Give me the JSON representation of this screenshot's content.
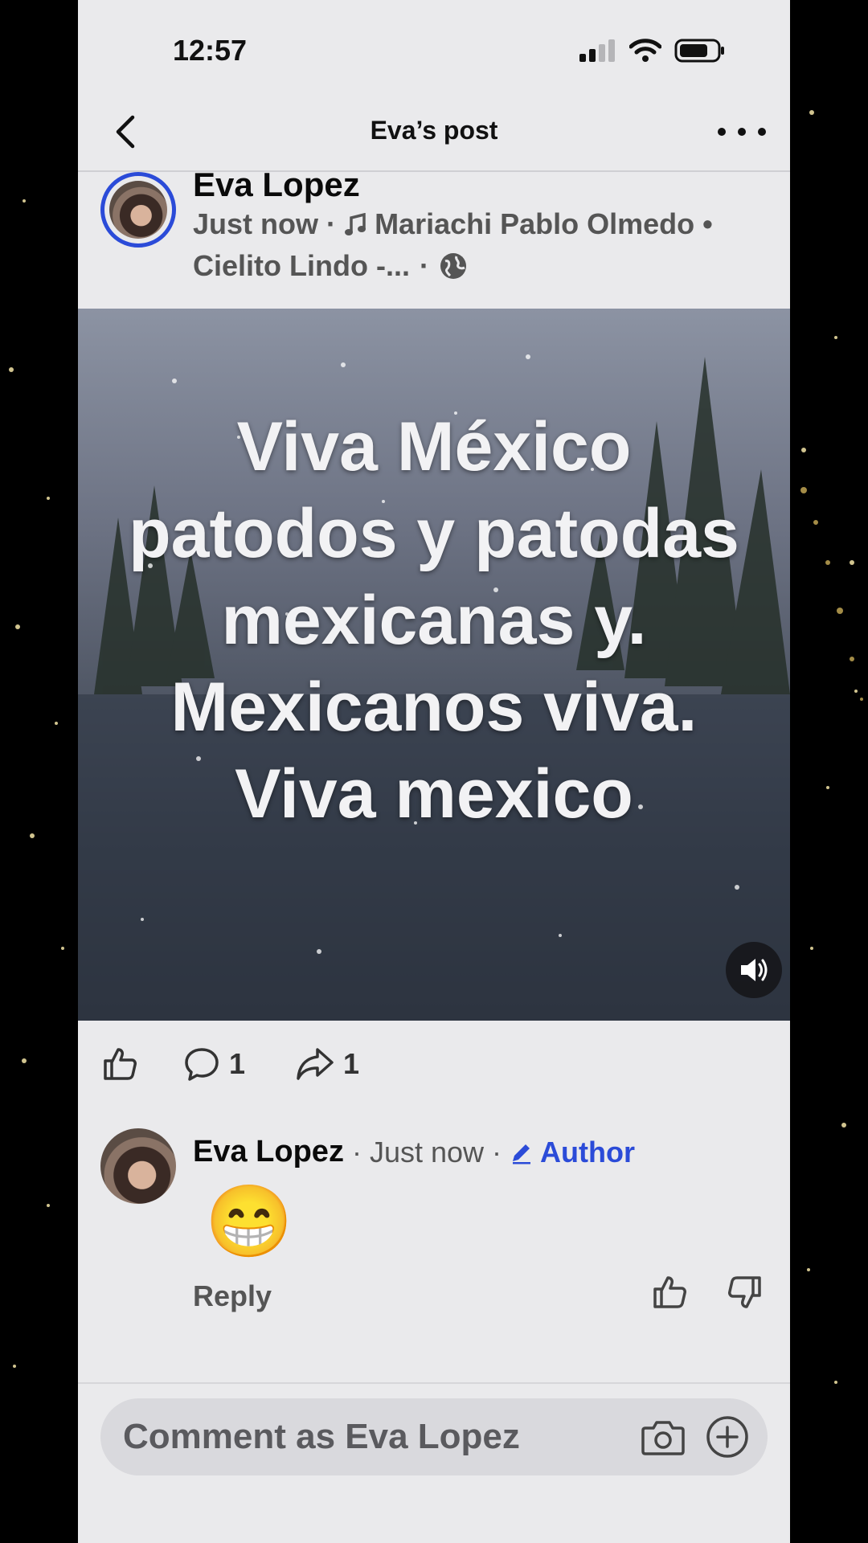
{
  "status_bar": {
    "time": "12:57"
  },
  "nav": {
    "title": "Eva’s post"
  },
  "post": {
    "author": "Eva Lopez",
    "time": "Just now",
    "separator": "·",
    "music_artist": "Mariachi Pablo Olmedo •",
    "music_track": "Cielito Lindo -...",
    "media_text": "Viva México patodos y patodas mexicanas y. Mexicanos viva. Viva mexico"
  },
  "actions": {
    "comment_count": "1",
    "share_count": "1"
  },
  "comment": {
    "author": "Eva Lopez",
    "time": "· Just now ·",
    "badge": "Author",
    "body": "😁",
    "reply_label": "Reply"
  },
  "composer": {
    "placeholder": "Comment as Eva Lopez"
  },
  "icons": [
    "back-icon",
    "more-icon",
    "music-note-icon",
    "globe-icon",
    "sound-on-icon",
    "like-icon",
    "comment-icon",
    "share-icon",
    "pencil-icon",
    "thumbs-up-icon",
    "thumbs-down-icon",
    "camera-icon",
    "plus-circle-icon"
  ],
  "colors": {
    "accent": "#2b4bd8",
    "background": "#eaeaec",
    "text": "#0a0a0a",
    "muted": "#555555"
  }
}
